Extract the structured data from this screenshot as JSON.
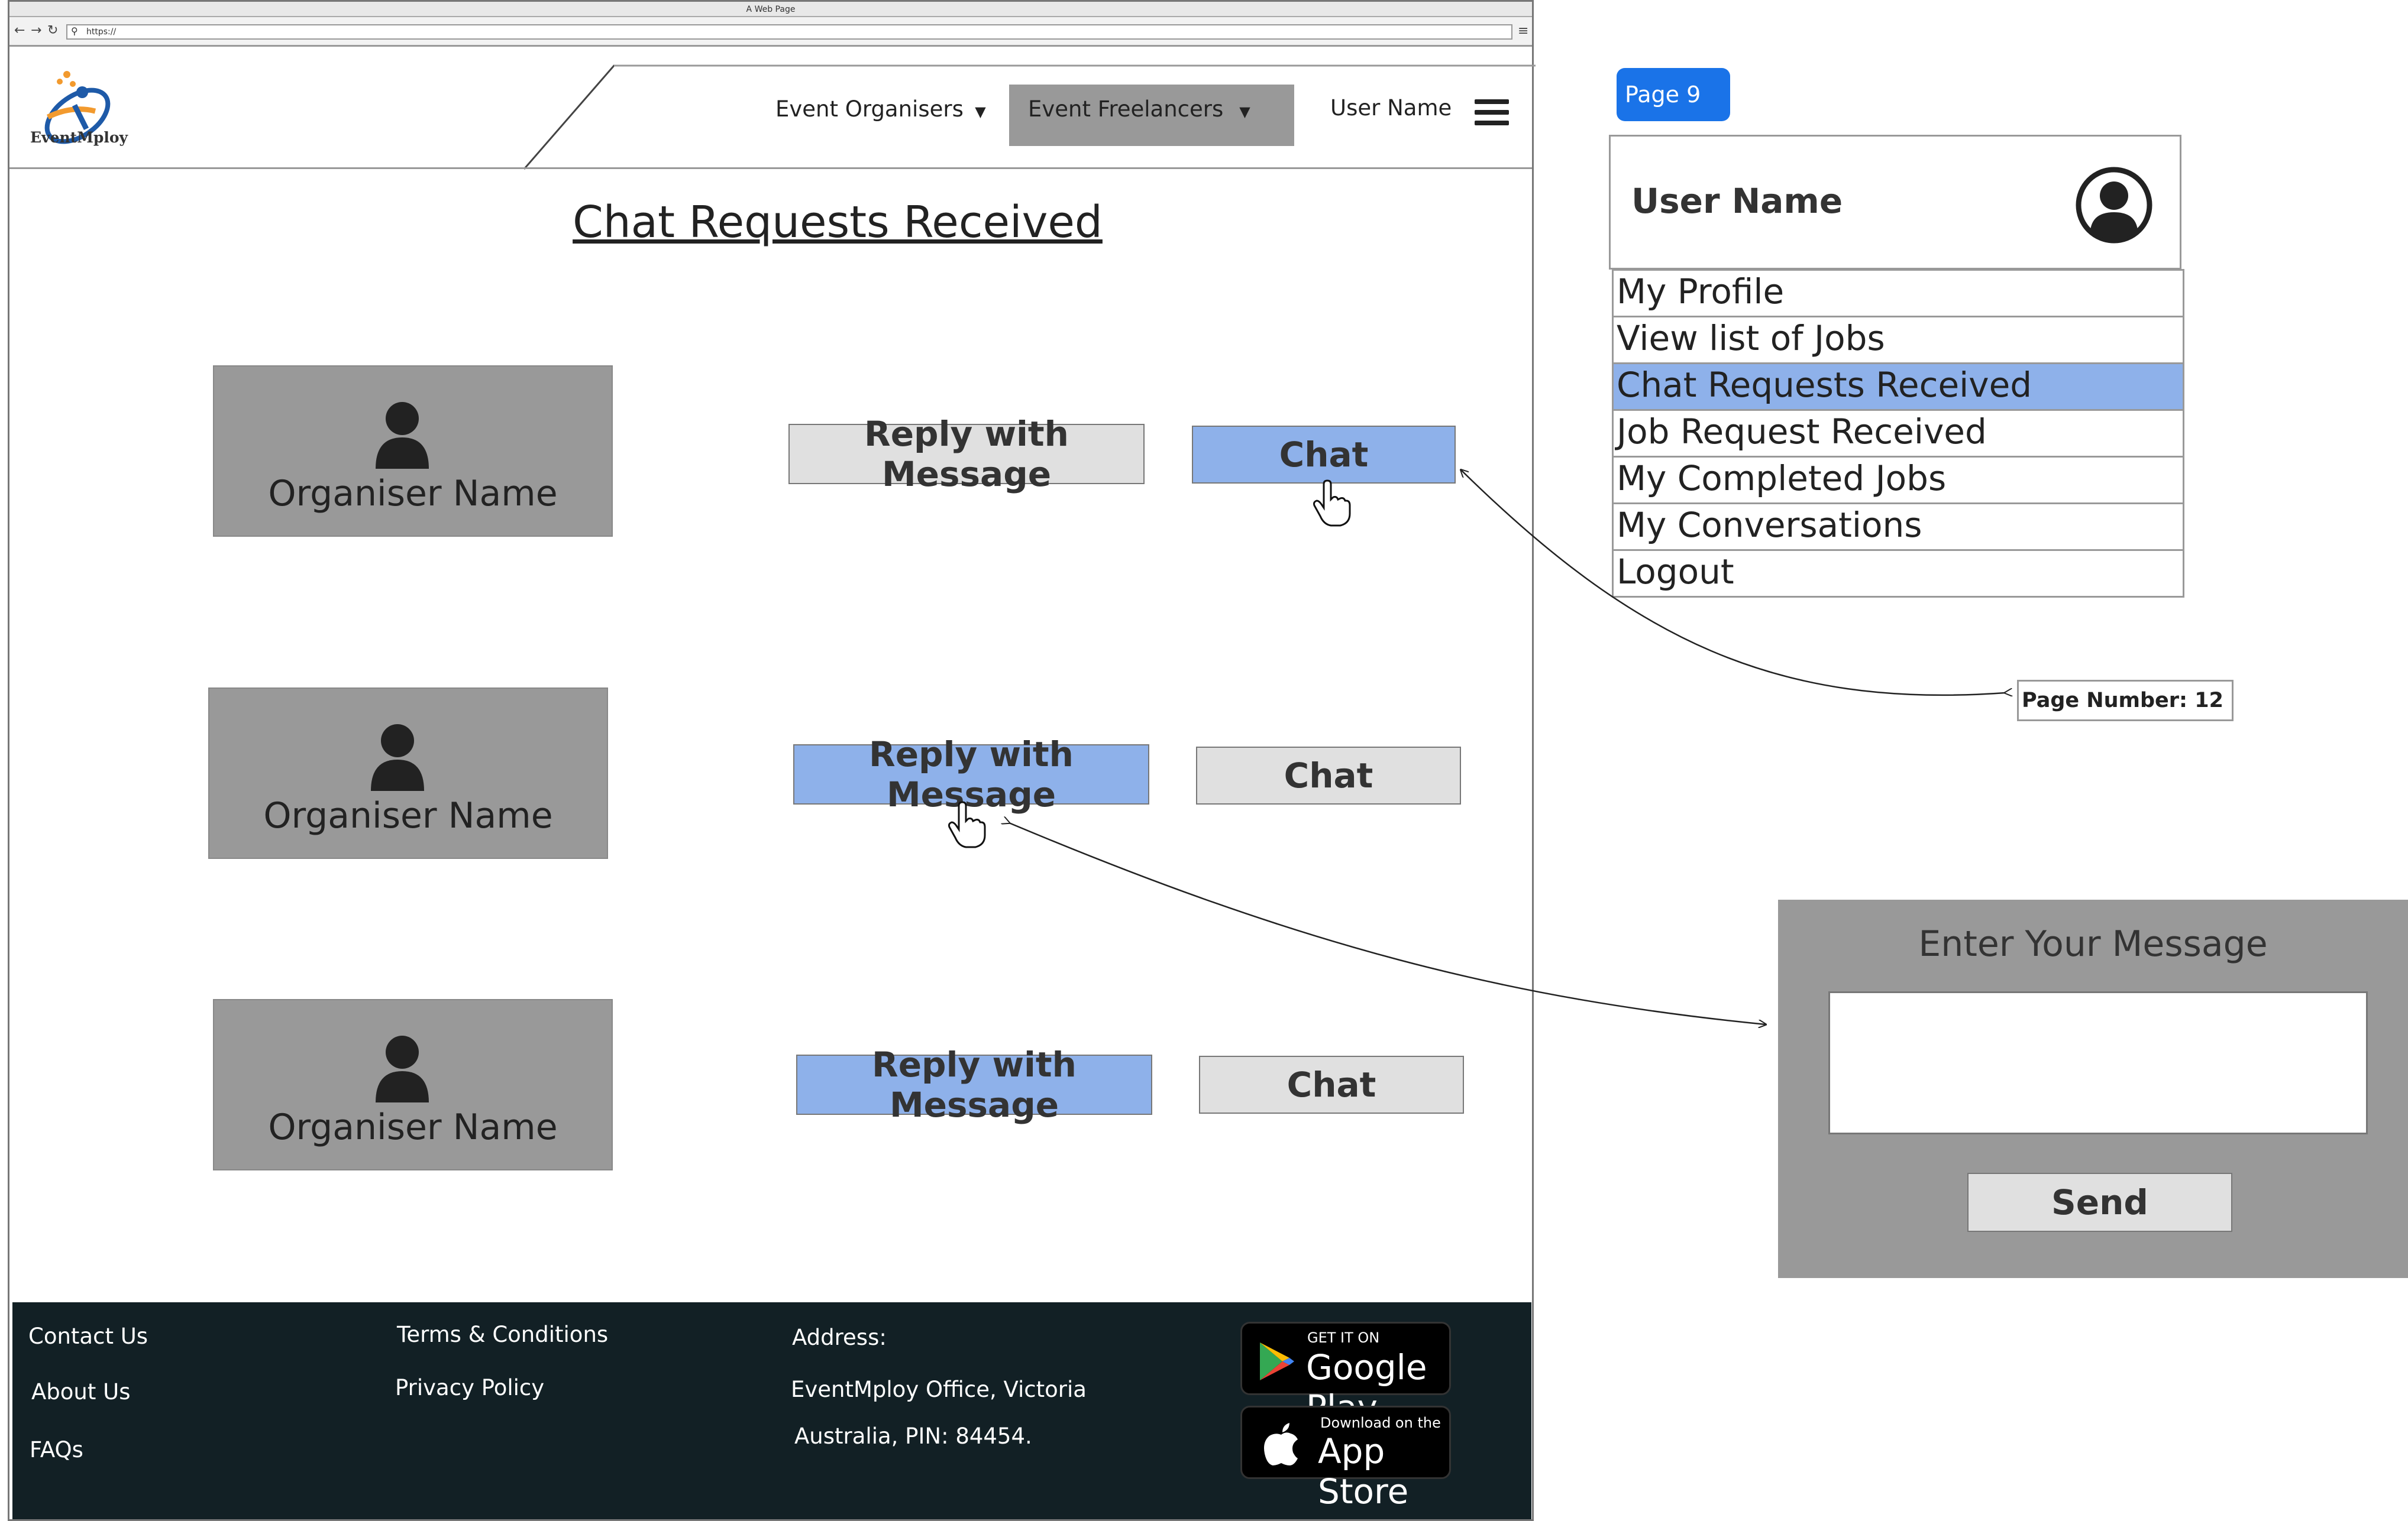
{
  "browser": {
    "window_title": "A Web Page",
    "url": "https://",
    "back_icon": "back-arrow-icon",
    "forward_icon": "forward-arrow-icon",
    "reload_icon": "reload-icon"
  },
  "header": {
    "logo_text": "EventMploy",
    "nav": {
      "organisers_label": "Event Organisers",
      "freelancers_label": "Event Freelancers",
      "user_label": "User Name"
    }
  },
  "main": {
    "title": "Chat Requests Received",
    "requests": [
      {
        "organiser_name": "Organiser Name",
        "reply_label": "Reply with Message",
        "chat_label": "Chat"
      },
      {
        "organiser_name": "Organiser Name",
        "reply_label": "Reply with Message",
        "chat_label": "Chat"
      },
      {
        "organiser_name": "Organiser Name",
        "reply_label": "Reply with Message",
        "chat_label": "Chat"
      }
    ]
  },
  "footer": {
    "contact": "Contact Us",
    "about": "About Us",
    "faqs": "FAQs",
    "terms": "Terms & Conditions",
    "privacy": "Privacy Policy",
    "address_label": "Address:",
    "address_line1": "EventMploy Office, Victoria",
    "address_line2": "Australia, PIN: 84454.",
    "google_play": {
      "small": "GET IT ON",
      "big": "Google Play"
    },
    "app_store": {
      "small": "Download on the",
      "big": "App Store"
    }
  },
  "annotations": {
    "page_badge": "Page 9",
    "user_panel_name": "User Name",
    "menu_items": [
      "My Profile",
      "View list of Jobs",
      "Chat Requests Received",
      "Job Request Received",
      "My Completed Jobs",
      "My Conversations",
      "Logout"
    ],
    "active_menu_index": 2,
    "page_number_label": "Page Number: 12",
    "message_panel": {
      "title": "Enter Your Message",
      "send_label": "Send",
      "input_value": ""
    }
  },
  "colors": {
    "highlight_blue": "#8eb1ea",
    "badge_blue": "#1a73e8",
    "footer_bg": "#122025",
    "card_gray": "#999999"
  }
}
